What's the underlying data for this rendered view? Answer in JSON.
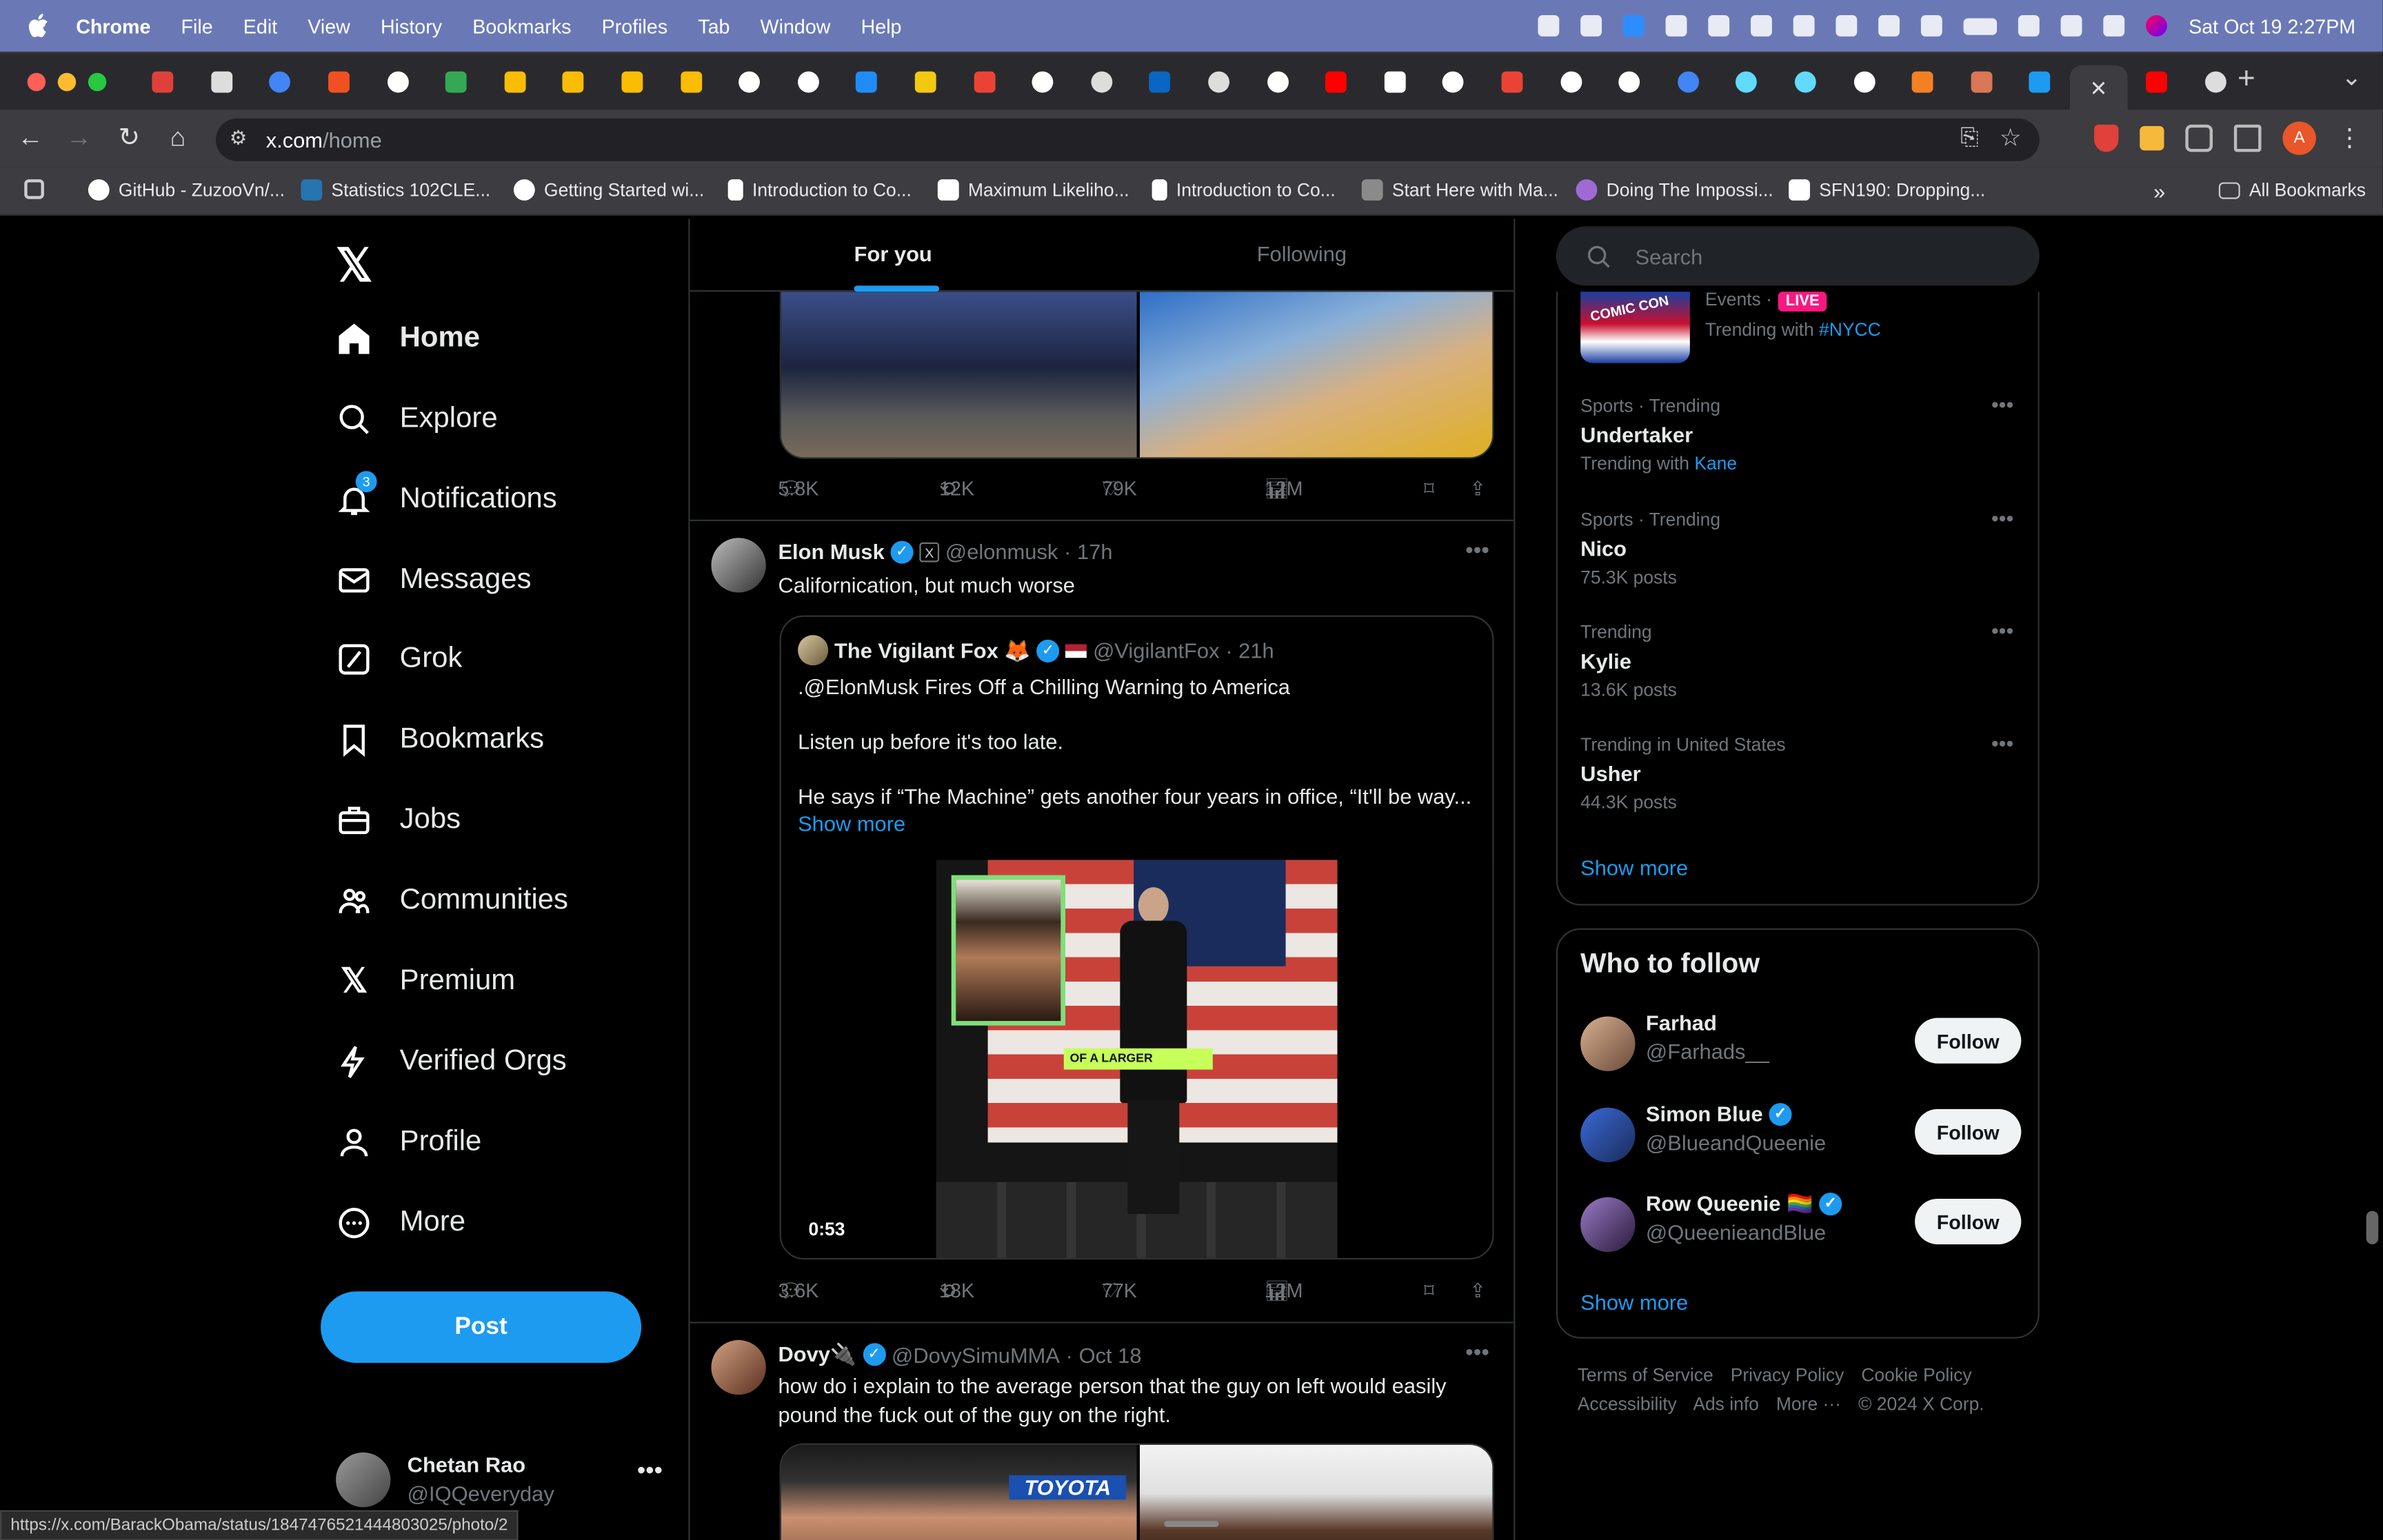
{
  "menubar": {
    "app": "Chrome",
    "items": [
      "File",
      "Edit",
      "View",
      "History",
      "Bookmarks",
      "Profiles",
      "Tab",
      "Window",
      "Help"
    ],
    "datetime": "Sat Oct 19  2:27PM"
  },
  "browser": {
    "url_host": "x.com",
    "url_path": "/home",
    "profile_initial": "A",
    "bookmarks": [
      {
        "label": "GitHub - ZuzooVn/..."
      },
      {
        "label": "Statistics 102CLE..."
      },
      {
        "label": "Getting Started wi..."
      },
      {
        "label": "Introduction to Co..."
      },
      {
        "label": "Maximum Likeliho..."
      },
      {
        "label": "Introduction to Co..."
      },
      {
        "label": "Start Here with Ma..."
      },
      {
        "label": "Doing The Impossi..."
      },
      {
        "label": "SFN190: Dropping..."
      }
    ],
    "all_bookmarks": "All Bookmarks",
    "status_url": "https://x.com/BarackObama/status/1847476521444803025/photo/2"
  },
  "sidebar": {
    "logo": "𝕏",
    "items": [
      {
        "label": "Home",
        "icon": "home-icon"
      },
      {
        "label": "Explore",
        "icon": "search-icon"
      },
      {
        "label": "Notifications",
        "icon": "bell-icon",
        "badge": "3"
      },
      {
        "label": "Messages",
        "icon": "envelope-icon"
      },
      {
        "label": "Grok",
        "icon": "grok-icon"
      },
      {
        "label": "Bookmarks",
        "icon": "bookmark-icon"
      },
      {
        "label": "Jobs",
        "icon": "briefcase-icon"
      },
      {
        "label": "Communities",
        "icon": "people-icon"
      },
      {
        "label": "Premium",
        "icon": "x-logo-icon"
      },
      {
        "label": "Verified Orgs",
        "icon": "lightning-icon"
      },
      {
        "label": "Profile",
        "icon": "person-icon"
      },
      {
        "label": "More",
        "icon": "more-circle-icon"
      }
    ],
    "post_label": "Post",
    "account": {
      "name": "Chetan Rao",
      "handle": "@IQQeveryday"
    }
  },
  "feed": {
    "tabs": [
      {
        "label": "For you"
      },
      {
        "label": "Following"
      }
    ],
    "tweet0": {
      "replies": "5.8K",
      "reposts": "12K",
      "likes": "79K",
      "views": "12M"
    },
    "tweet1": {
      "name": "Elon Musk",
      "handle": "@elonmusk",
      "time": "· 17h",
      "text": "Californication, but much worse",
      "quote": {
        "name": "The Vigilant Fox 🦊",
        "handle": "@VigilantFox",
        "time": "· 21h",
        "line1": ".@ElonMusk Fires Off a Chilling Warning to America",
        "line2": "Listen up before it's too late.",
        "line3": "He says if “The Machine” gets another four years in office, “It'll be way...",
        "show_more": "Show more",
        "video_time": "0:53",
        "lower_third": "OF A LARGER"
      },
      "replies": "3.6K",
      "reposts": "18K",
      "likes": "77K",
      "views": "12M"
    },
    "tweet2": {
      "name": "Dovy🔌",
      "handle": "@DovySimuMMA",
      "time": "· Oct 18",
      "text": "how do i explain to the average person that the guy on left would easily pound the fuck out of the guy on the right.",
      "banner": "TOYOTA"
    }
  },
  "right": {
    "search_placeholder": "Search",
    "event": {
      "meta": "Events ·",
      "live": "LIVE",
      "trend_prefix": "Trending with",
      "tag": "#NYCC"
    },
    "trends": [
      {
        "meta": "Sports · Trending",
        "name": "Undertaker",
        "sub_prefix": "Trending with",
        "sub_link": "Kane"
      },
      {
        "meta": "Sports · Trending",
        "name": "Nico",
        "sub": "75.3K posts"
      },
      {
        "meta": "Trending",
        "name": "Kylie",
        "sub": "13.6K posts"
      },
      {
        "meta": "Trending in United States",
        "name": "Usher",
        "sub": "44.3K posts"
      }
    ],
    "trends_show_more": "Show more",
    "who_to_follow": {
      "title": "Who to follow",
      "users": [
        {
          "name": "Farhad",
          "handle": "@Farhads__",
          "verified": false
        },
        {
          "name": "Simon Blue",
          "handle": "@BlueandQueenie",
          "verified": true
        },
        {
          "name": "Row Queenie 🏳️‍🌈",
          "handle": "@QueenieandBlue",
          "verified": true
        }
      ],
      "follow_label": "Follow",
      "show_more": "Show more"
    },
    "footer": [
      "Terms of Service",
      "Privacy Policy",
      "Cookie Policy",
      "Accessibility",
      "Ads info",
      "More ···",
      "© 2024 X Corp."
    ]
  },
  "colors": {
    "accent": "#1d9bf0",
    "live": "#f91880",
    "menubar": "#6a79b6"
  }
}
